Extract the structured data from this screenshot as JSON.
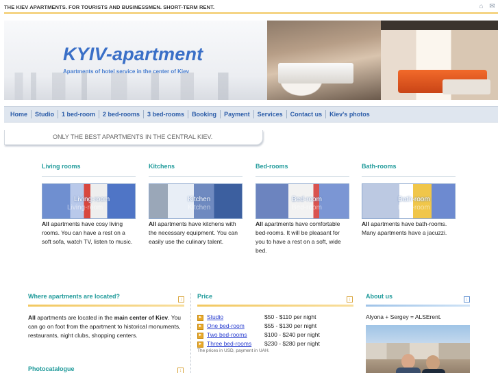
{
  "header": {
    "tagline": "THE KIEV APARTMENTS. FOR TOURISTS AND BUSINESSMEN. SHORT-TERM RENT.",
    "home_icon": "⌂",
    "mail_icon": "✉"
  },
  "banner": {
    "logo": "KYIV-apartment",
    "slogan": "Apartments of hotel service in the center of Kiev"
  },
  "nav": {
    "items": [
      "Home",
      "Studio",
      "1 bed-room",
      "2 bed-rooms",
      "3 bed-rooms",
      "Booking",
      "Payment",
      "Services",
      "Contact us",
      "Kiev's photos"
    ]
  },
  "promo": "ONLY THE BEST APARTMENTS IN THE CENTRAL KIEV.",
  "categories": [
    {
      "title": "Living rooms",
      "caption": "Living-room",
      "caption_shadow": "Living-room",
      "strong": "All",
      "text": " apartments have cosy living rooms. You can have a rest on a soft sofa, watch TV, listen to music."
    },
    {
      "title": "Kitchens",
      "caption": "Kitchen",
      "caption_shadow": "Kitchen",
      "strong": "All",
      "text": " apartments have kitchens with the necessary equipment. You can easily use the culinary talent."
    },
    {
      "title": "Bed-rooms",
      "caption": "Bed-room",
      "caption_shadow": "Bed-room",
      "strong": "All",
      "text": " apartments have comfortable bed-rooms. It will be pleasant for you to have a rest on a soft, wide bed."
    },
    {
      "title": "Bath-rooms",
      "caption": "Bath-room",
      "caption_shadow": "Bath-room",
      "strong": "All",
      "text": " apartments have bath-rooms. Many apartments have a jacuzzi."
    }
  ],
  "where": {
    "title": "Where apartments are located?",
    "strong1": "All",
    "text1": " apartments are located in the ",
    "strong2": "main center of Kiev",
    "text2": ". You can go on foot from the apartment to historical monuments, restaurants, night clubs, shopping centers."
  },
  "photocatalogue": {
    "title": "Photocatalogue"
  },
  "price": {
    "title": "Price",
    "rows": [
      {
        "name": "Studio",
        "value": "$50 - $110 per night"
      },
      {
        "name": "One bed-room",
        "value": "$55 - $130 per night"
      },
      {
        "name": "Two bed-rooms",
        "value": "$100 - $240 per night"
      },
      {
        "name": "Three bed-rooms",
        "value": "$230 - $280 per night"
      }
    ],
    "note": "The prices in USD, payment in UAH."
  },
  "about": {
    "title": "About us",
    "text": "Alyona + Sergey = ALSErent."
  },
  "colors": {
    "accent_teal": "#1f9a9a",
    "nav_text": "#2b5ca8",
    "logo_blue": "#3a6fc7",
    "gold_rule": "#f2c860"
  }
}
